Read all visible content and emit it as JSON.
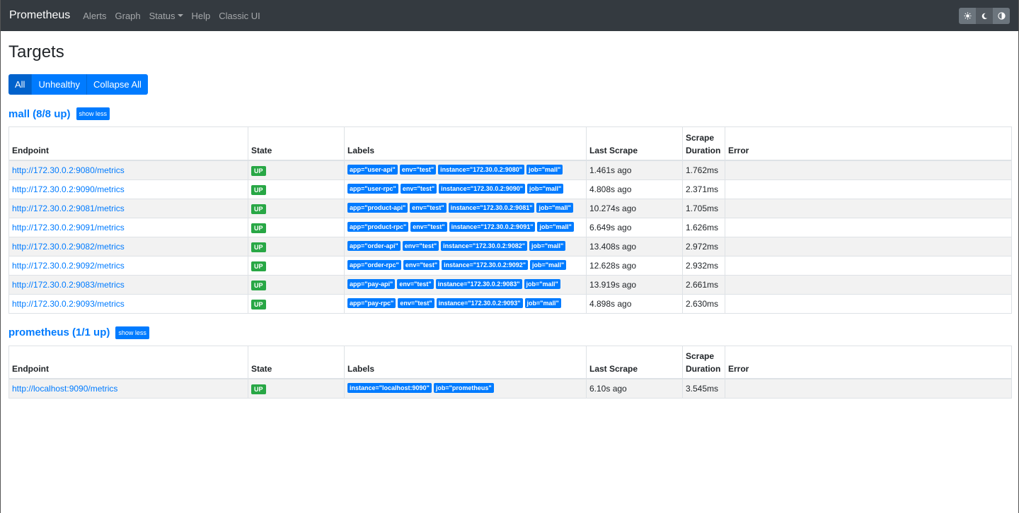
{
  "navbar": {
    "brand": "Prometheus",
    "links": [
      "Alerts",
      "Graph",
      "Status",
      "Help",
      "Classic UI"
    ],
    "theme_icons": [
      "sun-icon",
      "moon-icon",
      "contrast-icon"
    ]
  },
  "page_title": "Targets",
  "filters": [
    "All",
    "Unhealthy",
    "Collapse All"
  ],
  "columns": [
    "Endpoint",
    "State",
    "Labels",
    "Last Scrape",
    "Scrape Duration",
    "Error"
  ],
  "pools": [
    {
      "title": "mall (8/8 up)",
      "toggle": "show less",
      "targets": [
        {
          "endpoint": "http://172.30.0.2:9080/metrics",
          "state": "UP",
          "labels": [
            "app=\"user-api\"",
            "env=\"test\"",
            "instance=\"172.30.0.2:9080\"",
            "job=\"mall\""
          ],
          "last_scrape": "1.461s ago",
          "duration": "1.762ms",
          "error": ""
        },
        {
          "endpoint": "http://172.30.0.2:9090/metrics",
          "state": "UP",
          "labels": [
            "app=\"user-rpc\"",
            "env=\"test\"",
            "instance=\"172.30.0.2:9090\"",
            "job=\"mall\""
          ],
          "last_scrape": "4.808s ago",
          "duration": "2.371ms",
          "error": ""
        },
        {
          "endpoint": "http://172.30.0.2:9081/metrics",
          "state": "UP",
          "labels": [
            "app=\"product-api\"",
            "env=\"test\"",
            "instance=\"172.30.0.2:9081\"",
            "job=\"mall\""
          ],
          "last_scrape": "10.274s ago",
          "duration": "1.705ms",
          "error": ""
        },
        {
          "endpoint": "http://172.30.0.2:9091/metrics",
          "state": "UP",
          "labels": [
            "app=\"product-rpc\"",
            "env=\"test\"",
            "instance=\"172.30.0.2:9091\"",
            "job=\"mall\""
          ],
          "last_scrape": "6.649s ago",
          "duration": "1.626ms",
          "error": ""
        },
        {
          "endpoint": "http://172.30.0.2:9082/metrics",
          "state": "UP",
          "labels": [
            "app=\"order-api\"",
            "env=\"test\"",
            "instance=\"172.30.0.2:9082\"",
            "job=\"mall\""
          ],
          "last_scrape": "13.408s ago",
          "duration": "2.972ms",
          "error": ""
        },
        {
          "endpoint": "http://172.30.0.2:9092/metrics",
          "state": "UP",
          "labels": [
            "app=\"order-rpc\"",
            "env=\"test\"",
            "instance=\"172.30.0.2:9092\"",
            "job=\"mall\""
          ],
          "last_scrape": "12.628s ago",
          "duration": "2.932ms",
          "error": ""
        },
        {
          "endpoint": "http://172.30.0.2:9083/metrics",
          "state": "UP",
          "labels": [
            "app=\"pay-api\"",
            "env=\"test\"",
            "instance=\"172.30.0.2:9083\"",
            "job=\"mall\""
          ],
          "last_scrape": "13.919s ago",
          "duration": "2.661ms",
          "error": ""
        },
        {
          "endpoint": "http://172.30.0.2:9093/metrics",
          "state": "UP",
          "labels": [
            "app=\"pay-rpc\"",
            "env=\"test\"",
            "instance=\"172.30.0.2:9093\"",
            "job=\"mall\""
          ],
          "last_scrape": "4.898s ago",
          "duration": "2.630ms",
          "error": ""
        }
      ]
    },
    {
      "title": "prometheus (1/1 up)",
      "toggle": "show less",
      "targets": [
        {
          "endpoint": "http://localhost:9090/metrics",
          "state": "UP",
          "labels": [
            "instance=\"localhost:9090\"",
            "job=\"prometheus\""
          ],
          "last_scrape": "6.10s ago",
          "duration": "3.545ms",
          "error": ""
        }
      ]
    }
  ]
}
